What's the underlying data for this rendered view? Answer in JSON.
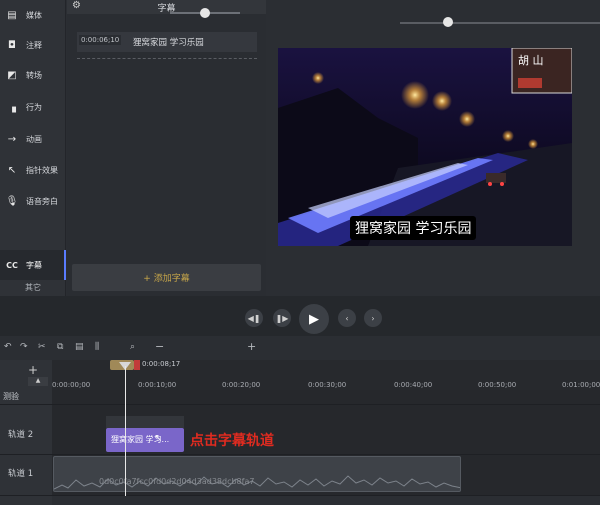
{
  "sidebar": {
    "items": [
      {
        "label": "媒体",
        "icon": "film-icon"
      },
      {
        "label": "注释",
        "icon": "annotation-icon"
      },
      {
        "label": "转场",
        "icon": "transition-icon"
      },
      {
        "label": "行为",
        "icon": "behavior-icon"
      },
      {
        "label": "动画",
        "icon": "animation-icon"
      },
      {
        "label": "指针效果",
        "icon": "cursor-effect-icon"
      },
      {
        "label": "语音旁白",
        "icon": "microphone-icon"
      },
      {
        "label": "字幕",
        "icon": "cc-icon"
      }
    ],
    "icon_glyphs": [
      "▤",
      "◘",
      "◩",
      "▗",
      "→",
      "↖",
      "🎙",
      "CC"
    ],
    "other_label": "其它"
  },
  "captions": {
    "title": "字幕",
    "row": {
      "time": "0:00:06;10",
      "text": "狸窝家园 学习乐园"
    },
    "add_label": "+ 添加字幕"
  },
  "preview": {
    "subtitle": "狸窝家园 学习乐园",
    "sign_text": "胡 山"
  },
  "timeline": {
    "playhead_time": "0:00:08;17",
    "ticks": [
      "0:00:00;00",
      "0:00:10;00",
      "0:00:20;00",
      "0:00:30;00",
      "0:00:40;00",
      "0:00:50;00",
      "0:01:00;00"
    ],
    "test_label": "测验",
    "tracks": [
      {
        "label": "轨道 2"
      },
      {
        "label": "轨道 1"
      }
    ],
    "caption_clip_text": "狸窝家园 学习...",
    "video_clip_text": "0d0c0fa7fcc0fd0d2d04d3ad38dcb8fa7",
    "annotation": "点击字幕轨道"
  },
  "colors": {
    "accent": "#5a7cff",
    "caption_clip": "#7a66c9",
    "annotation_red": "#e02b20",
    "add_caption_text": "#c7a64a"
  }
}
